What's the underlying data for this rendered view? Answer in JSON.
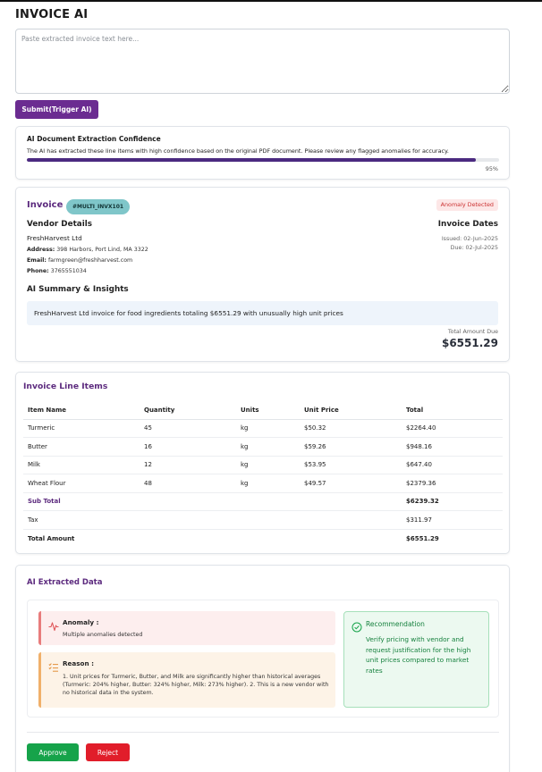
{
  "app": {
    "title": "INVOICE AI"
  },
  "input": {
    "placeholder": "Paste extracted invoice text here...",
    "submit_label": "Submit(Trigger AI)"
  },
  "confidence": {
    "title": "AI Document Extraction Confidence",
    "description": "The AI has extracted these line items with high confidence based on the original PDF document. Please review any flagged anomalies for accuracy.",
    "percent_label": "95%",
    "percent": 95
  },
  "invoice": {
    "title": "Invoice",
    "id_tag": "#MULTI_INVX101",
    "status_badge": "Anomaly Detected",
    "vendor_heading": "Vendor Details",
    "vendor_name": "FreshHarvest Ltd",
    "address_label": "Address:",
    "address": "398 Harbors, Port Lind, MA 3322",
    "email_label": "Email:",
    "email": "farmgreen@freshharvest.com",
    "phone_label": "Phone:",
    "phone": "3765551034",
    "dates_heading": "Invoice Dates",
    "issued": "Issued: 02-Jun-2025",
    "due": "Due: 02-Jul-2025",
    "summary_heading": "AI Summary & Insights",
    "summary": "FreshHarvest Ltd invoice for food ingredients totaling $6551.29 with unusually high unit prices",
    "total_label": "Total Amount Due",
    "total_value": "$6551.29"
  },
  "line_items": {
    "heading": "Invoice Line Items",
    "columns": [
      "Item Name",
      "Quantity",
      "Units",
      "Unit Price",
      "Total"
    ],
    "rows": [
      [
        "Turmeric",
        "45",
        "kg",
        "$50.32",
        "$2264.40"
      ],
      [
        "Butter",
        "16",
        "kg",
        "$59.26",
        "$948.16"
      ],
      [
        "Milk",
        "12",
        "kg",
        "$53.95",
        "$647.40"
      ],
      [
        "Wheat Flour",
        "48",
        "kg",
        "$49.57",
        "$2379.36"
      ]
    ],
    "subtotal_label": "Sub Total",
    "subtotal_value": "$6239.32",
    "tax_label": "Tax",
    "tax_value": "$311.97",
    "total_label": "Total Amount",
    "total_value": "$6551.29"
  },
  "ai_data": {
    "heading": "AI Extracted Data",
    "anomaly_title": "Anomaly :",
    "anomaly_text": "Multiple anomalies detected",
    "reason_title": "Reason :",
    "reason_text": "1. Unit prices for Turmeric, Butter, and Milk are significantly higher than historical averages (Turmeric: 204% higher, Butter: 324% higher, Milk: 273% higher). 2. This is a new vendor with no historical data in the system.",
    "recommendation_title": "Recommendation",
    "recommendation_text": "Verify pricing with vendor and request justification for the high unit prices compared to market rates",
    "approve_label": "Approve",
    "reject_label": "Reject"
  },
  "colors": {
    "brand_purple": "#6b2c91",
    "approve_green": "#16a34a",
    "reject_red": "#e11d2a",
    "tag_teal": "#7fc6c9"
  }
}
